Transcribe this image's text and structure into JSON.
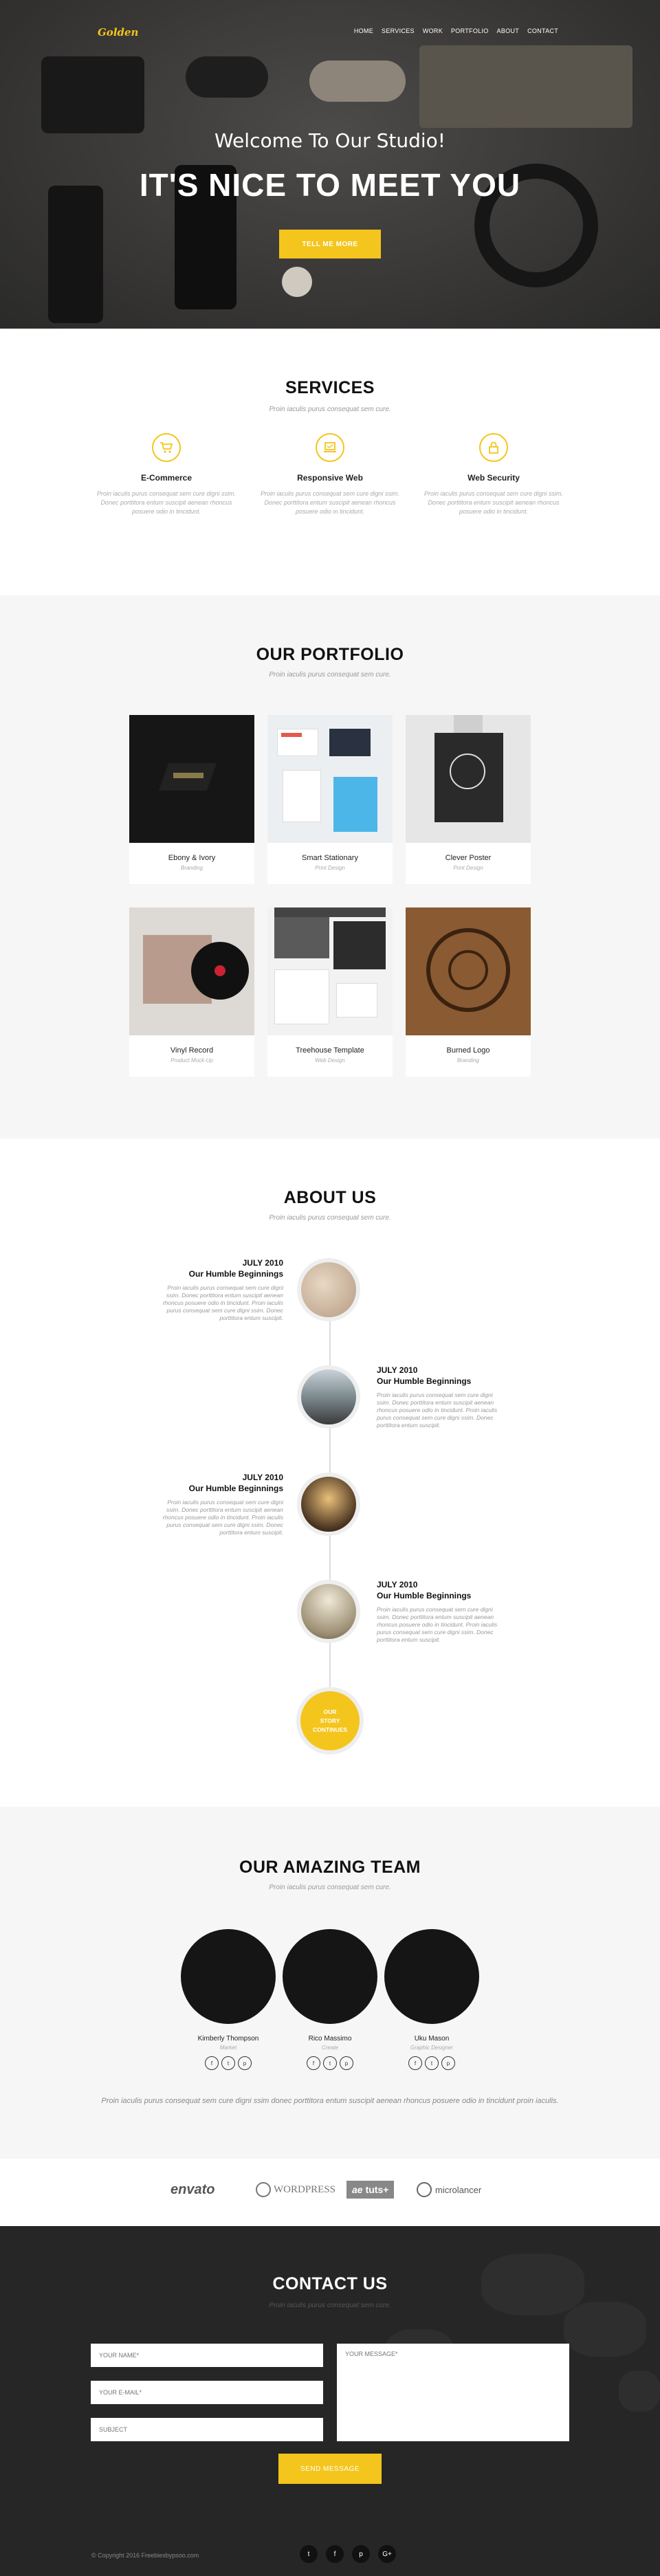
{
  "nav": {
    "logo": "Golden",
    "links": [
      "HOME",
      "SERVICES",
      "WORK",
      "PORTFOLIO",
      "ABOUT",
      "CONTACT"
    ]
  },
  "hero": {
    "subtitle": "Welcome To Our Studio!",
    "title": "IT'S NICE TO MEET YOU",
    "button": "TELL ME MORE"
  },
  "services": {
    "title": "SERVICES",
    "subtitle": "Proin iaculis purus consequat sem cure.",
    "items": [
      {
        "icon": "cart-icon",
        "name": "E-Commerce",
        "text": "Proin iaculis purus consequat sem cure digni ssim. Donec porttitora entum suscipit aenean rhoncus posuere odio in tincidunt."
      },
      {
        "icon": "laptop-icon",
        "name": "Responsive Web",
        "text": "Proin iaculis purus consequat sem cure digni ssim. Donec porttitora entum suscipit aenean rhoncus posuere odio in tincidunt."
      },
      {
        "icon": "lock-icon",
        "name": "Web Security",
        "text": "Proin iaculis purus consequat sem cure digni ssim. Donec porttitora entum suscipit aenean rhoncus posuere odio in tincidunt."
      }
    ]
  },
  "portfolio": {
    "title": "OUR PORTFOLIO",
    "subtitle": "Proin iaculis purus consequat sem cure.",
    "items": [
      {
        "name": "Ebony & Ivory",
        "category": "Branding"
      },
      {
        "name": "Smart Stationary",
        "category": "Print Design"
      },
      {
        "name": "Clever Poster",
        "category": "Print Design"
      },
      {
        "name": "Vinyl Record",
        "category": "Product Mock-Up"
      },
      {
        "name": "Treehouse Template",
        "category": "Web Design"
      },
      {
        "name": "Burned Logo",
        "category": "Branding"
      }
    ]
  },
  "about": {
    "title": "ABOUT US",
    "subtitle": "Proin iaculis purus consequat sem cure.",
    "events": [
      {
        "date": "JULY 2010",
        "heading": "Our Humble Beginnings",
        "text": "Proin iaculis purus consequat sem cure digni ssim. Donec porttitora entum suscipit aenean rhoncus posuere odio in tincidunt. Proin iaculis purus consequat sem cure digni ssim. Donec porttitora entum suscipit."
      },
      {
        "date": "JULY 2010",
        "heading": "Our Humble Beginnings",
        "text": "Proin iaculis purus consequat sem cure digni ssim. Donec porttitora entum suscipit aenean rhoncus posuere odio in tincidunt. Proin iaculis purus consequat sem cure digni ssim. Donec porttitora entum suscipit."
      },
      {
        "date": "JULY 2010",
        "heading": "Our Humble Beginnings",
        "text": "Proin iaculis purus consequat sem cure digni ssim. Donec porttitora entum suscipit aenean rhoncus posuere odio in tincidunt. Proin iaculis purus consequat sem cure digni ssim. Donec porttitora entum suscipit."
      },
      {
        "date": "JULY 2010",
        "heading": "Our Humble Beginnings",
        "text": "Proin iaculis purus consequat sem cure digni ssim. Donec porttitora entum suscipit aenean rhoncus posuere odio in tincidunt. Proin iaculis purus consequat sem cure digni ssim. Donec porttitora entum suscipit."
      }
    ],
    "story": [
      "OUR",
      "STORY",
      "CONTINUES"
    ]
  },
  "team": {
    "title": "OUR AMAZING TEAM",
    "subtitle": "Proin iaculis purus consequat sem cure.",
    "members": [
      {
        "name": "Kimberly Thompson",
        "role": "Market"
      },
      {
        "name": "Rico Massimo",
        "role": "Create"
      },
      {
        "name": "Uku Mason",
        "role": "Graphic Designer"
      }
    ],
    "note": "Proin iaculis purus consequat sem cure digni ssim donec porttitora entum suscipit aenean rhoncus posuere odio in tincidunt proin iaculis."
  },
  "clients": [
    "envato",
    "WORDPRESS",
    "tuts+",
    "microlancer"
  ],
  "contact": {
    "title": "CONTACT US",
    "subtitle": "Proin iaculis purus consequat sem cure.",
    "name_placeholder": "YOUR NAME*",
    "email_placeholder": "YOUR E-MAIL*",
    "subject_placeholder": "SUBJECT",
    "message_placeholder": "YOUR MESSAGE*",
    "send": "SEND MESSAGE"
  },
  "footer": {
    "copyright": "© Copyright 2016 Freebiesbypsoo.com"
  },
  "colors": {
    "accent": "#f4c51c",
    "dark": "#262626",
    "light": "#f6f6f6"
  }
}
